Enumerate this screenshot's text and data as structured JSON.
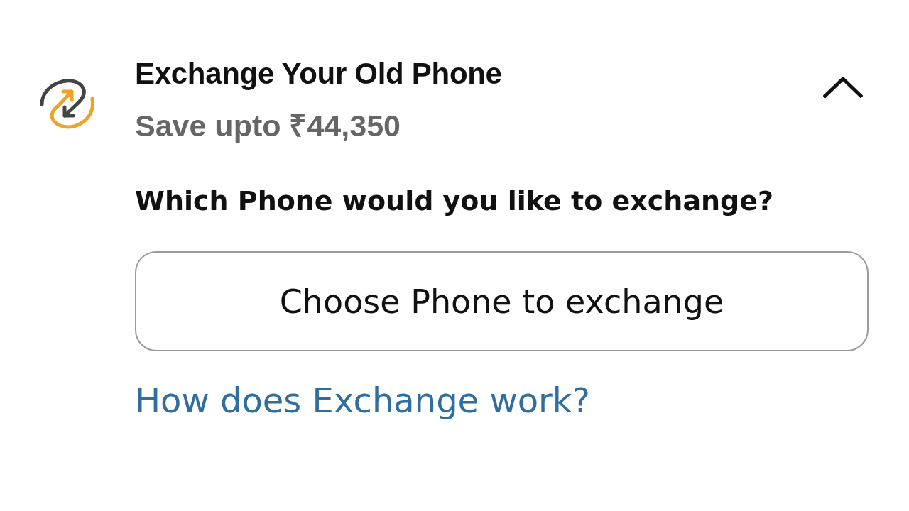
{
  "section": {
    "title": "Exchange Your Old Phone",
    "subtitle": "Save upto ₹44,350",
    "expanded": true,
    "question": "Which Phone would you like to exchange?",
    "choose_button": "Choose Phone to exchange",
    "help_link": "How does Exchange work?"
  }
}
